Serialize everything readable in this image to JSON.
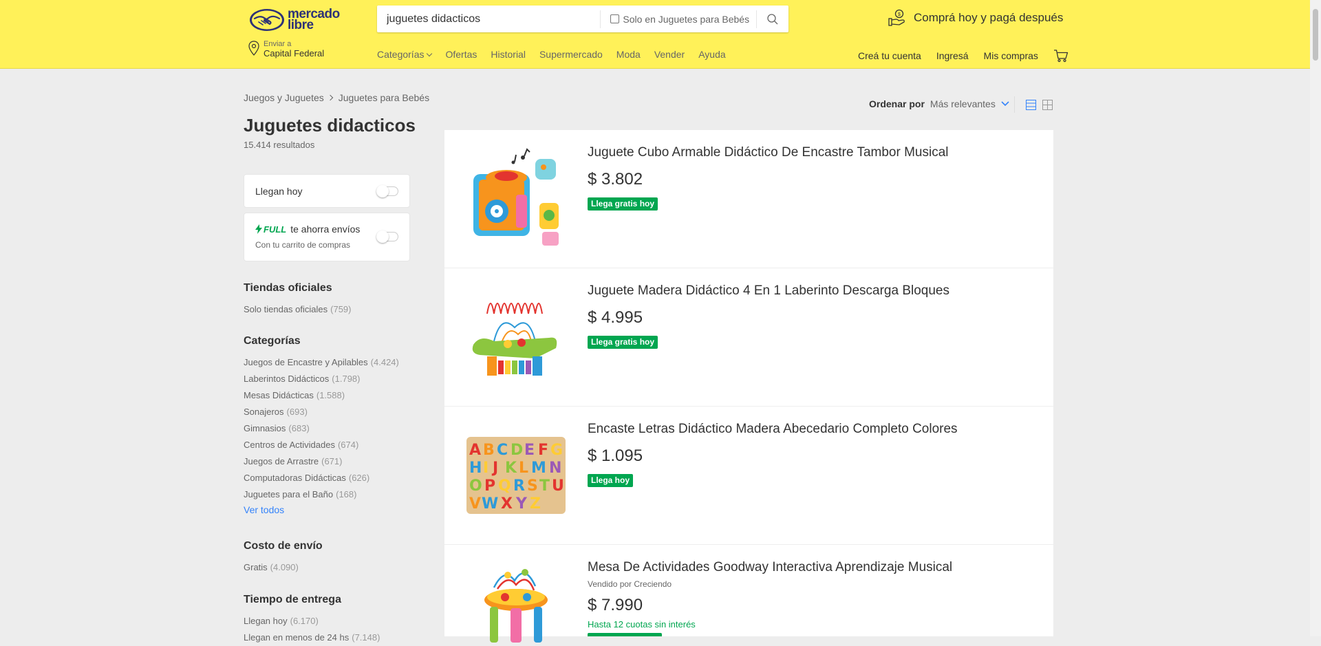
{
  "header": {
    "logo_line1": "mercado",
    "logo_line2": "libre",
    "search_value": "juguetes didacticos",
    "search_scope_label": "Solo en Juguetes para Bebés",
    "promo_text": "Comprá hoy y pagá después",
    "location_small": "Enviar a",
    "location_big": "Capital Federal",
    "nav": [
      "Categorías",
      "Ofertas",
      "Historial",
      "Supermercado",
      "Moda",
      "Vender",
      "Ayuda"
    ],
    "user_nav": [
      "Creá tu cuenta",
      "Ingresá",
      "Mis compras"
    ]
  },
  "breadcrumb": [
    "Juegos y Juguetes",
    "Juguetes para Bebés"
  ],
  "page_title": "Juguetes didacticos",
  "results_count": "15.414 resultados",
  "filters": {
    "today_label": "Llegan hoy",
    "full_badge": "FULL",
    "full_text": "te ahorra envíos",
    "full_sub": "Con tu carrito de compras"
  },
  "sidebar": {
    "official_title": "Tiendas oficiales",
    "official_item": "Solo tiendas oficiales",
    "official_count": "(759)",
    "categories_title": "Categorías",
    "categories": [
      {
        "label": "Juegos de Encastre y Apilables",
        "count": "(4.424)"
      },
      {
        "label": "Laberintos Didácticos",
        "count": "(1.798)"
      },
      {
        "label": "Mesas Didácticas",
        "count": "(1.588)"
      },
      {
        "label": "Sonajeros",
        "count": "(693)"
      },
      {
        "label": "Gimnasios",
        "count": "(683)"
      },
      {
        "label": "Centros de Actividades",
        "count": "(674)"
      },
      {
        "label": "Juegos de Arrastre",
        "count": "(671)"
      },
      {
        "label": "Computadoras Didácticas",
        "count": "(626)"
      },
      {
        "label": "Juguetes para el Baño",
        "count": "(168)"
      }
    ],
    "see_all": "Ver todos",
    "shipping_title": "Costo de envío",
    "shipping_item": "Gratis",
    "shipping_count": "(4.090)",
    "delivery_title": "Tiempo de entrega",
    "delivery_item": "Llegan hoy",
    "delivery_count": "(6.170)",
    "delivery_item2": "Llegan en menos de 24 hs",
    "delivery_count2": "(7.148)"
  },
  "sort": {
    "label": "Ordenar por",
    "value": "Más relevantes"
  },
  "items": [
    {
      "title": "Juguete Cubo Armable Didáctico De Encastre Tambor Musical",
      "price": "$ 3.802",
      "badge": "Llega gratis hoy"
    },
    {
      "title": "Juguete Madera Didáctico 4 En 1 Laberinto Descarga Bloques",
      "price": "$ 4.995",
      "badge": "Llega gratis hoy"
    },
    {
      "title": "Encaste Letras Didáctico Madera Abecedario Completo Colores",
      "price": "$ 1.095",
      "badge": "Llega hoy"
    },
    {
      "title": "Mesa De Actividades Goodway Interactiva Aprendizaje Musical",
      "seller": "Vendido por Creciendo",
      "price": "$ 7.990",
      "installments": "Hasta 12 cuotas sin interés"
    }
  ],
  "colors": {
    "header_bg": "#fff159",
    "accent_blue": "#3483fa",
    "green": "#00a650",
    "page_bg": "#ededed"
  }
}
